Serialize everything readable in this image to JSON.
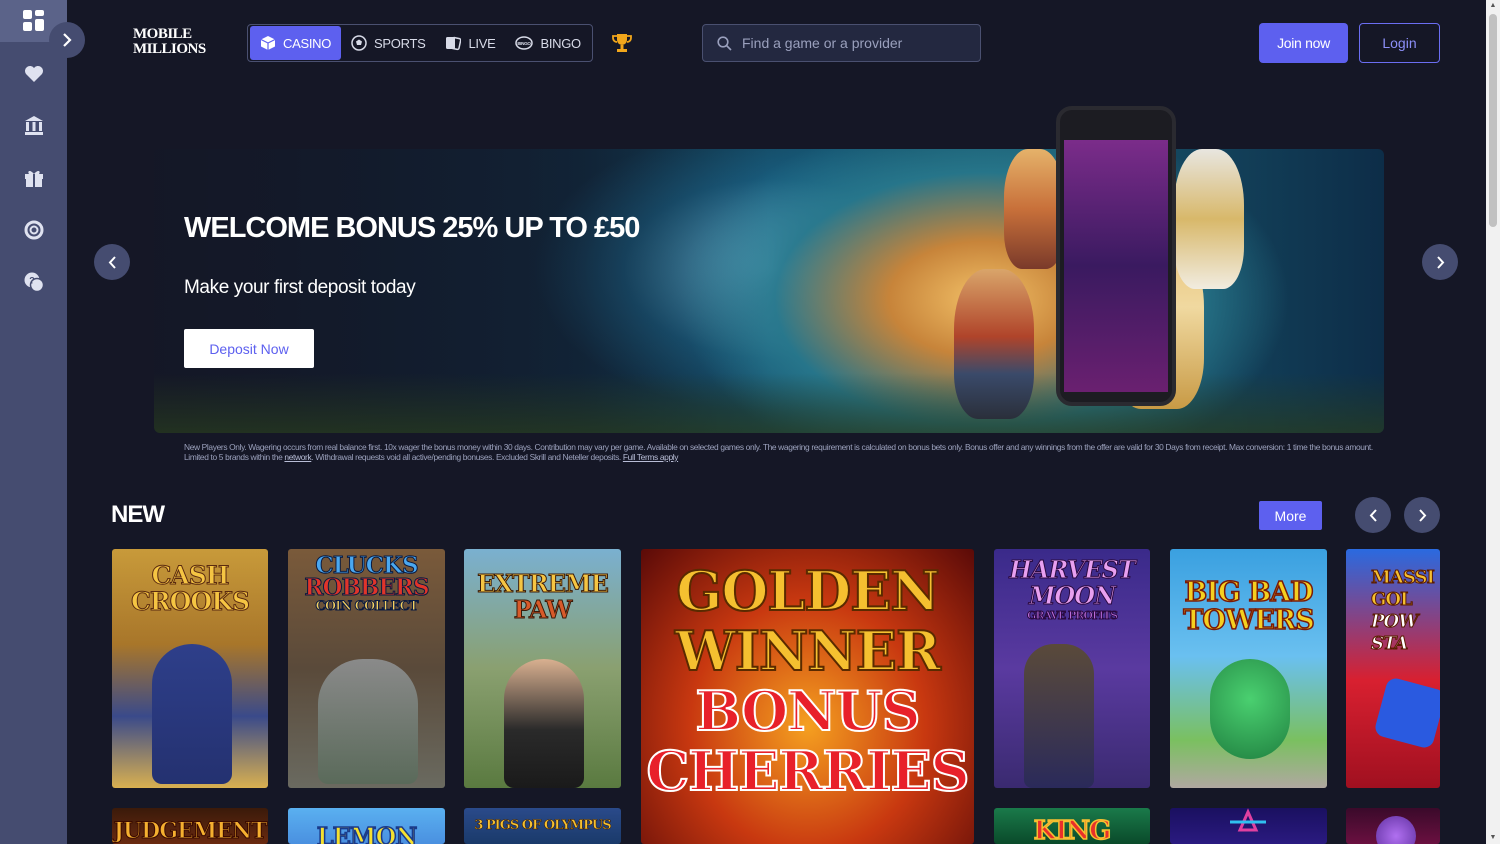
{
  "sidebar": {
    "items": [
      {
        "icon": "grid-icon"
      },
      {
        "icon": "heart-icon"
      },
      {
        "icon": "bank-icon"
      },
      {
        "icon": "gift-icon"
      },
      {
        "icon": "lifebuoy-icon"
      },
      {
        "icon": "help-chat-icon"
      }
    ]
  },
  "header": {
    "logo_line1": "MOBILE",
    "logo_line2": "MILLIONS",
    "tabs": [
      {
        "label": "CASINO",
        "icon": "cube-icon",
        "active": true
      },
      {
        "label": "SPORTS",
        "icon": "soccer-ball-icon",
        "active": false
      },
      {
        "label": "LIVE",
        "icon": "cards-icon",
        "active": false
      },
      {
        "label": "BINGO",
        "icon": "bingo-ball-icon",
        "active": false
      }
    ],
    "search_placeholder": "Find a game or a provider",
    "join_label": "Join now",
    "login_label": "Login"
  },
  "hero": {
    "title": "WELCOME BONUS 25% UP TO £50",
    "subtitle": "Make your first deposit today",
    "cta_label": "Deposit Now",
    "terms_part1": "New Players Only. Wagering occurs from real balance first. 10x wager the bonus money within 30 days. Contribution may vary per game. Available on selected games only. The wagering requirement is calculated on bonus bets only. Bonus offer and any winnings from the offer are valid for 30 Days from receipt. Max conversion: 1 time the bonus amount. Limited to 5 brands within the ",
    "terms_link1": "network",
    "terms_part2": ". Withdrawal requests void all active/pending bonuses. Excluded Skrill and Neteller deposits. ",
    "terms_link2": "Full Terms apply"
  },
  "new_section": {
    "title": "NEW",
    "more_label": "More",
    "games": [
      {
        "title_line1": "CASH",
        "title_line2": "CROOKS"
      },
      {
        "title_line1": "CLUCKS",
        "title_line2": "ROBBERS",
        "title_line3": "COIN COLLECT"
      },
      {
        "title_line1": "EXTREME",
        "title_line2": "PAW"
      },
      {
        "title_line1": "GOLDEN",
        "title_line2": "WINNER",
        "title_line3": "BONUS",
        "title_line4": "CHERRIES"
      },
      {
        "title_line1": "HARVEST",
        "title_line2": "MOON",
        "title_line3": "GRAVE PROFITS"
      },
      {
        "title_line1": "BIG BAD",
        "title_line2": "TOWERS"
      },
      {
        "title_line1": "MASSI",
        "title_line2": "GOL",
        "title_line3": "POW",
        "title_line4": "STA"
      }
    ],
    "row2": [
      {
        "title": "JUDGEMENT"
      },
      {
        "title": "LEMON"
      },
      {
        "title": "3 PIGS OF OLYMPUS"
      },
      {
        "title": "KING"
      }
    ]
  },
  "colors": {
    "accent": "#5d60ef",
    "background": "#151726",
    "sidebar": "#454c70"
  }
}
